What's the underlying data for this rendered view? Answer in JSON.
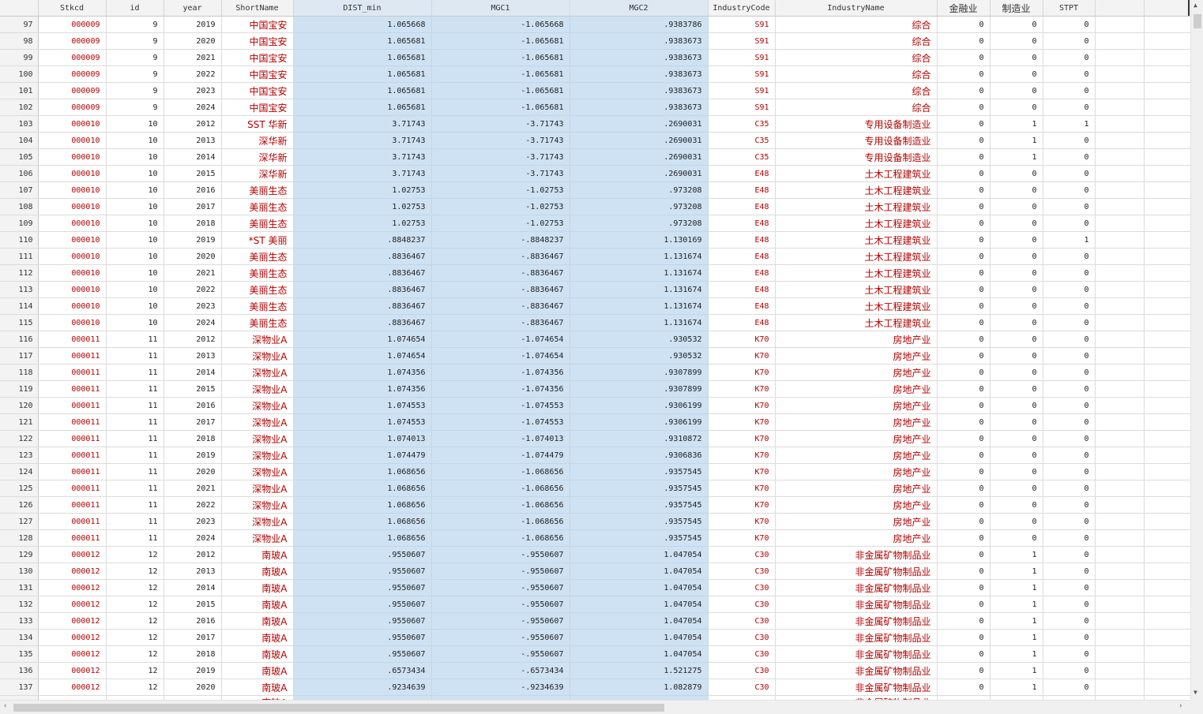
{
  "columns": [
    "",
    "Stkcd",
    "id",
    "year",
    "ShortName",
    "DIST_min",
    "MGC1",
    "MGC2",
    "IndustryCode",
    "IndustryName",
    "金融业",
    "制造业",
    "STPT",
    "",
    ""
  ],
  "rows": [
    [
      "97",
      "000009",
      "9",
      "2019",
      "中国宝安",
      "1.065668",
      "-1.065668",
      ".9383786",
      "S91",
      "综合",
      "0",
      "0",
      "0",
      "",
      ""
    ],
    [
      "98",
      "000009",
      "9",
      "2020",
      "中国宝安",
      "1.065681",
      "-1.065681",
      ".9383673",
      "S91",
      "综合",
      "0",
      "0",
      "0",
      "",
      ""
    ],
    [
      "99",
      "000009",
      "9",
      "2021",
      "中国宝安",
      "1.065681",
      "-1.065681",
      ".9383673",
      "S91",
      "综合",
      "0",
      "0",
      "0",
      "",
      ""
    ],
    [
      "100",
      "000009",
      "9",
      "2022",
      "中国宝安",
      "1.065681",
      "-1.065681",
      ".9383673",
      "S91",
      "综合",
      "0",
      "0",
      "0",
      "",
      ""
    ],
    [
      "101",
      "000009",
      "9",
      "2023",
      "中国宝安",
      "1.065681",
      "-1.065681",
      ".9383673",
      "S91",
      "综合",
      "0",
      "0",
      "0",
      "",
      ""
    ],
    [
      "102",
      "000009",
      "9",
      "2024",
      "中国宝安",
      "1.065681",
      "-1.065681",
      ".9383673",
      "S91",
      "综合",
      "0",
      "0",
      "0",
      "",
      ""
    ],
    [
      "103",
      "000010",
      "10",
      "2012",
      "SST 华新",
      "3.71743",
      "-3.71743",
      ".2690031",
      "C35",
      "专用设备制造业",
      "0",
      "1",
      "1",
      "",
      ""
    ],
    [
      "104",
      "000010",
      "10",
      "2013",
      "深华新",
      "3.71743",
      "-3.71743",
      ".2690031",
      "C35",
      "专用设备制造业",
      "0",
      "1",
      "0",
      "",
      ""
    ],
    [
      "105",
      "000010",
      "10",
      "2014",
      "深华新",
      "3.71743",
      "-3.71743",
      ".2690031",
      "C35",
      "专用设备制造业",
      "0",
      "1",
      "0",
      "",
      ""
    ],
    [
      "106",
      "000010",
      "10",
      "2015",
      "深华新",
      "3.71743",
      "-3.71743",
      ".2690031",
      "E48",
      "土木工程建筑业",
      "0",
      "0",
      "0",
      "",
      ""
    ],
    [
      "107",
      "000010",
      "10",
      "2016",
      "美丽生态",
      "1.02753",
      "-1.02753",
      ".973208",
      "E48",
      "土木工程建筑业",
      "0",
      "0",
      "0",
      "",
      ""
    ],
    [
      "108",
      "000010",
      "10",
      "2017",
      "美丽生态",
      "1.02753",
      "-1.02753",
      ".973208",
      "E48",
      "土木工程建筑业",
      "0",
      "0",
      "0",
      "",
      ""
    ],
    [
      "109",
      "000010",
      "10",
      "2018",
      "美丽生态",
      "1.02753",
      "-1.02753",
      ".973208",
      "E48",
      "土木工程建筑业",
      "0",
      "0",
      "0",
      "",
      ""
    ],
    [
      "110",
      "000010",
      "10",
      "2019",
      "*ST 美丽",
      ".8848237",
      "-.8848237",
      "1.130169",
      "E48",
      "土木工程建筑业",
      "0",
      "0",
      "1",
      "",
      ""
    ],
    [
      "111",
      "000010",
      "10",
      "2020",
      "美丽生态",
      ".8836467",
      "-.8836467",
      "1.131674",
      "E48",
      "土木工程建筑业",
      "0",
      "0",
      "0",
      "",
      ""
    ],
    [
      "112",
      "000010",
      "10",
      "2021",
      "美丽生态",
      ".8836467",
      "-.8836467",
      "1.131674",
      "E48",
      "土木工程建筑业",
      "0",
      "0",
      "0",
      "",
      ""
    ],
    [
      "113",
      "000010",
      "10",
      "2022",
      "美丽生态",
      ".8836467",
      "-.8836467",
      "1.131674",
      "E48",
      "土木工程建筑业",
      "0",
      "0",
      "0",
      "",
      ""
    ],
    [
      "114",
      "000010",
      "10",
      "2023",
      "美丽生态",
      ".8836467",
      "-.8836467",
      "1.131674",
      "E48",
      "土木工程建筑业",
      "0",
      "0",
      "0",
      "",
      ""
    ],
    [
      "115",
      "000010",
      "10",
      "2024",
      "美丽生态",
      ".8836467",
      "-.8836467",
      "1.131674",
      "E48",
      "土木工程建筑业",
      "0",
      "0",
      "0",
      "",
      ""
    ],
    [
      "116",
      "000011",
      "11",
      "2012",
      "深物业A",
      "1.074654",
      "-1.074654",
      ".930532",
      "K70",
      "房地产业",
      "0",
      "0",
      "0",
      "",
      ""
    ],
    [
      "117",
      "000011",
      "11",
      "2013",
      "深物业A",
      "1.074654",
      "-1.074654",
      ".930532",
      "K70",
      "房地产业",
      "0",
      "0",
      "0",
      "",
      ""
    ],
    [
      "118",
      "000011",
      "11",
      "2014",
      "深物业A",
      "1.074356",
      "-1.074356",
      ".9307899",
      "K70",
      "房地产业",
      "0",
      "0",
      "0",
      "",
      ""
    ],
    [
      "119",
      "000011",
      "11",
      "2015",
      "深物业A",
      "1.074356",
      "-1.074356",
      ".9307899",
      "K70",
      "房地产业",
      "0",
      "0",
      "0",
      "",
      ""
    ],
    [
      "120",
      "000011",
      "11",
      "2016",
      "深物业A",
      "1.074553",
      "-1.074553",
      ".9306199",
      "K70",
      "房地产业",
      "0",
      "0",
      "0",
      "",
      ""
    ],
    [
      "121",
      "000011",
      "11",
      "2017",
      "深物业A",
      "1.074553",
      "-1.074553",
      ".9306199",
      "K70",
      "房地产业",
      "0",
      "0",
      "0",
      "",
      ""
    ],
    [
      "122",
      "000011",
      "11",
      "2018",
      "深物业A",
      "1.074013",
      "-1.074013",
      ".9310872",
      "K70",
      "房地产业",
      "0",
      "0",
      "0",
      "",
      ""
    ],
    [
      "123",
      "000011",
      "11",
      "2019",
      "深物业A",
      "1.074479",
      "-1.074479",
      ".9306836",
      "K70",
      "房地产业",
      "0",
      "0",
      "0",
      "",
      ""
    ],
    [
      "124",
      "000011",
      "11",
      "2020",
      "深物业A",
      "1.068656",
      "-1.068656",
      ".9357545",
      "K70",
      "房地产业",
      "0",
      "0",
      "0",
      "",
      ""
    ],
    [
      "125",
      "000011",
      "11",
      "2021",
      "深物业A",
      "1.068656",
      "-1.068656",
      ".9357545",
      "K70",
      "房地产业",
      "0",
      "0",
      "0",
      "",
      ""
    ],
    [
      "126",
      "000011",
      "11",
      "2022",
      "深物业A",
      "1.068656",
      "-1.068656",
      ".9357545",
      "K70",
      "房地产业",
      "0",
      "0",
      "0",
      "",
      ""
    ],
    [
      "127",
      "000011",
      "11",
      "2023",
      "深物业A",
      "1.068656",
      "-1.068656",
      ".9357545",
      "K70",
      "房地产业",
      "0",
      "0",
      "0",
      "",
      ""
    ],
    [
      "128",
      "000011",
      "11",
      "2024",
      "深物业A",
      "1.068656",
      "-1.068656",
      ".9357545",
      "K70",
      "房地产业",
      "0",
      "0",
      "0",
      "",
      ""
    ],
    [
      "129",
      "000012",
      "12",
      "2012",
      "南玻A",
      ".9550607",
      "-.9550607",
      "1.047054",
      "C30",
      "非金属矿物制品业",
      "0",
      "1",
      "0",
      "",
      ""
    ],
    [
      "130",
      "000012",
      "12",
      "2013",
      "南玻A",
      ".9550607",
      "-.9550607",
      "1.047054",
      "C30",
      "非金属矿物制品业",
      "0",
      "1",
      "0",
      "",
      ""
    ],
    [
      "131",
      "000012",
      "12",
      "2014",
      "南玻A",
      ".9550607",
      "-.9550607",
      "1.047054",
      "C30",
      "非金属矿物制品业",
      "0",
      "1",
      "0",
      "",
      ""
    ],
    [
      "132",
      "000012",
      "12",
      "2015",
      "南玻A",
      ".9550607",
      "-.9550607",
      "1.047054",
      "C30",
      "非金属矿物制品业",
      "0",
      "1",
      "0",
      "",
      ""
    ],
    [
      "133",
      "000012",
      "12",
      "2016",
      "南玻A",
      ".9550607",
      "-.9550607",
      "1.047054",
      "C30",
      "非金属矿物制品业",
      "0",
      "1",
      "0",
      "",
      ""
    ],
    [
      "134",
      "000012",
      "12",
      "2017",
      "南玻A",
      ".9550607",
      "-.9550607",
      "1.047054",
      "C30",
      "非金属矿物制品业",
      "0",
      "1",
      "0",
      "",
      ""
    ],
    [
      "135",
      "000012",
      "12",
      "2018",
      "南玻A",
      ".9550607",
      "-.9550607",
      "1.047054",
      "C30",
      "非金属矿物制品业",
      "0",
      "1",
      "0",
      "",
      ""
    ],
    [
      "136",
      "000012",
      "12",
      "2019",
      "南玻A",
      ".6573434",
      "-.6573434",
      "1.521275",
      "C30",
      "非金属矿物制品业",
      "0",
      "1",
      "0",
      "",
      ""
    ],
    [
      "137",
      "000012",
      "12",
      "2020",
      "南玻A",
      ".9234639",
      "-.9234639",
      "1.082879",
      "C30",
      "非金属矿物制品业",
      "0",
      "1",
      "0",
      "",
      ""
    ],
    [
      "",
      "",
      "",
      "",
      "南玻A",
      "",
      "",
      "",
      "",
      "非金属矿物制品业",
      "",
      "",
      "",
      "",
      ""
    ]
  ],
  "scrollbars": {
    "left_arrow": "‹",
    "right_arrow": "›",
    "up_arrow": "▲",
    "down_arrow": "▼"
  }
}
